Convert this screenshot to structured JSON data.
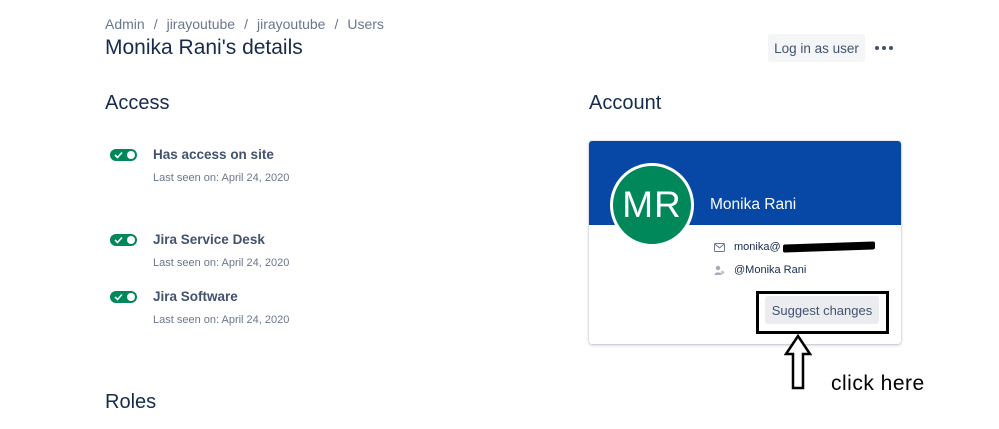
{
  "breadcrumb": [
    "Admin",
    "jirayoutube",
    "jirayoutube",
    "Users"
  ],
  "page_title": "Monika Rani's details",
  "header_actions": {
    "login_label": "Log in as user",
    "more_icon": "ellipsis-icon"
  },
  "access": {
    "title": "Access",
    "items": [
      {
        "label": "Has access on site",
        "last_seen": "Last seen on: April 24, 2020",
        "enabled": true
      },
      {
        "label": "Jira Service Desk",
        "last_seen": "Last seen on: April 24, 2020",
        "enabled": true
      },
      {
        "label": "Jira Software",
        "last_seen": "Last seen on: April 24, 2020",
        "enabled": true
      }
    ]
  },
  "roles": {
    "title": "Roles"
  },
  "account": {
    "title": "Account",
    "initials": "MR",
    "name": "Monika Rani",
    "email_visible": "monika@",
    "username": "@Monika Rani",
    "suggest_label": "Suggest changes"
  },
  "annotation": {
    "text": "click here"
  },
  "colors": {
    "banner": "#0747a6",
    "avatar": "#00875a",
    "toggle_on": "#00875a",
    "heading": "#172b4d",
    "muted": "#6b778c"
  }
}
